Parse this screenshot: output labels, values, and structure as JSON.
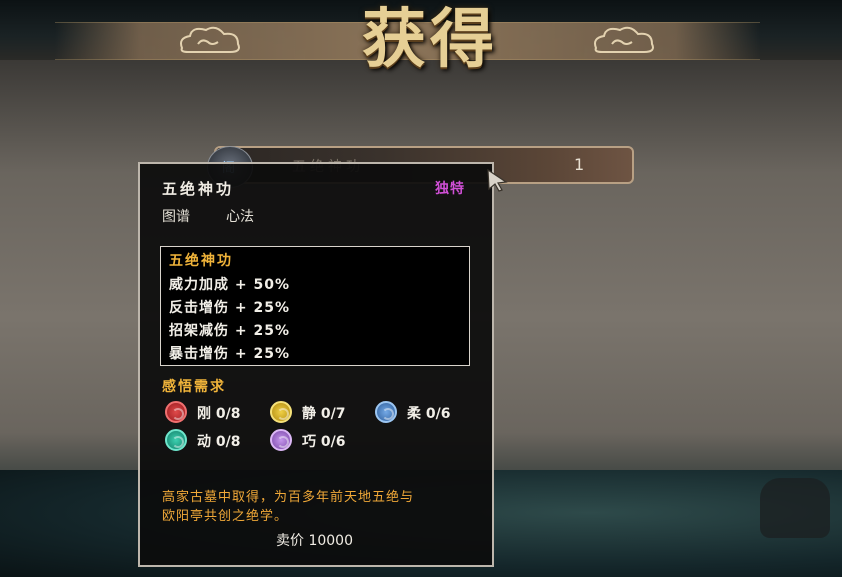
{
  "header": {
    "title": "获得"
  },
  "reward_row": {
    "icon": "manual-icon",
    "icon_glyph": "阁",
    "name": "五绝神功",
    "quantity": "1"
  },
  "tooltip": {
    "name": "五绝神功",
    "rarity": "独特",
    "rarity_color": "#d04fd6",
    "type": "图谱",
    "category": "心法",
    "effects_title": "五绝神功",
    "effects": [
      "威力加成 + 50%",
      "反击增伤 + 25%",
      "招架减伤 + 25%",
      "暴击增伤 + 25%"
    ],
    "requirements_title": "感悟需求",
    "requirements": [
      {
        "label": "刚 0/8",
        "color": "#c22a30",
        "icon": "red-orb-icon"
      },
      {
        "label": "静 0/7",
        "color": "#d9b21e",
        "icon": "yellow-orb-icon"
      },
      {
        "label": "柔 0/6",
        "color": "#4a86c8",
        "icon": "blue-orb-icon"
      },
      {
        "label": "动 0/8",
        "color": "#23a58c",
        "icon": "teal-orb-icon"
      },
      {
        "label": "巧 0/6",
        "color": "#a86fd0",
        "icon": "purple-orb-icon"
      }
    ],
    "description_lines": [
      "高家古墓中取得，为百多年前天地五绝与",
      "欧阳亭共创之绝学。"
    ],
    "price": "卖价 10000"
  }
}
